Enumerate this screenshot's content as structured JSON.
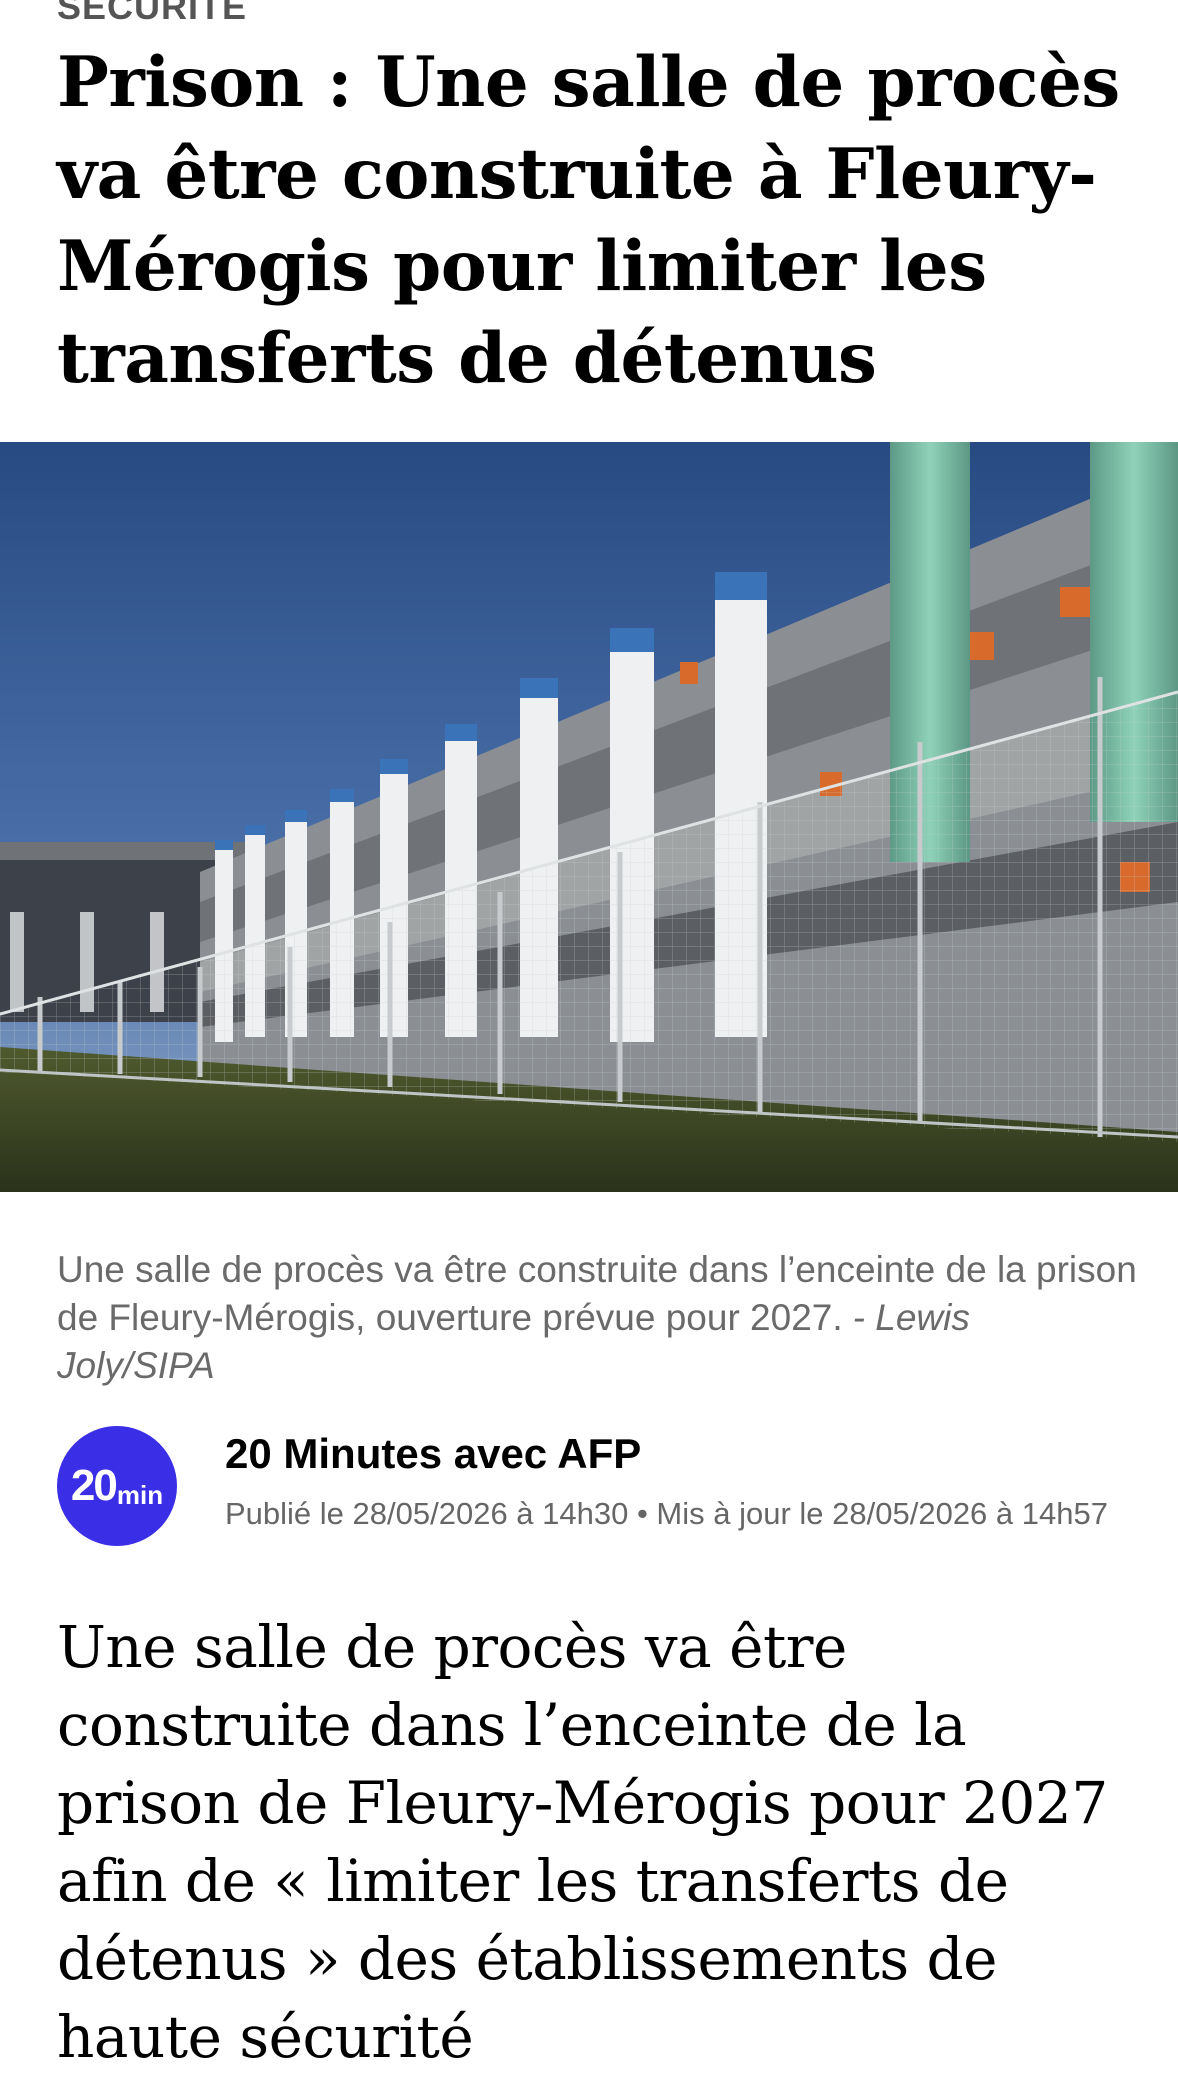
{
  "article": {
    "kicker": "SÉCURITÉ",
    "headline": "Prison : Une salle de procès va être construite à Fleury-Mérogis pour limiter les transferts de détenus",
    "image": {
      "alt": "",
      "caption": "Une salle de procès va être construite dans l’enceinte de la prison de Fleury-Mérogis, ouverture prévue pour 2027.",
      "credit": "- Lewis Joly/SIPA"
    },
    "author": {
      "logo_text": "20",
      "logo_suffix": "min",
      "name": "20 Minutes avec AFP",
      "meta": "Publié le 28/05/2026 à 14h30 • Mis à jour le 28/05/2026 à 14h57"
    },
    "lead": "Une salle de procès va être construite dans l’enceinte de la prison de Fleury-Mérogis pour 2027 afin de « limiter les transferts de détenus » des établissements de haute sécurité"
  },
  "colors": {
    "brand": "#3a2ee6",
    "caption_text": "#6a6a6a",
    "kicker_text": "#555555"
  }
}
